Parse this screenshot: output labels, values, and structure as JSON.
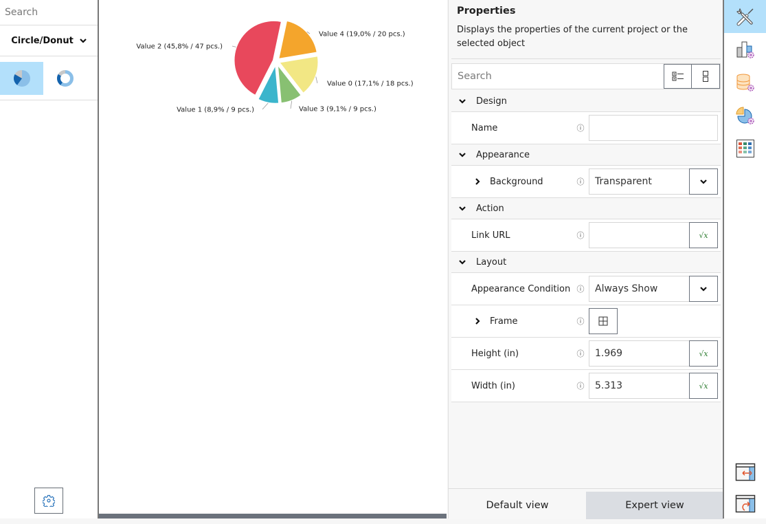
{
  "left_panel": {
    "search_placeholder": "Search",
    "chart_type": "Circle/Donut",
    "variants": [
      {
        "name": "pie",
        "selected": true
      },
      {
        "name": "donut",
        "selected": false
      }
    ],
    "settings_icon": "gear-icon"
  },
  "chart_data": {
    "type": "pie",
    "title": "",
    "series": [
      {
        "label": "Value 4 (19,0% / 20 pcs.)",
        "name": "Value 4",
        "percent": 19.0,
        "count": 20,
        "color": "#f4a52c"
      },
      {
        "label": "Value 0 (17,1% / 18 pcs.)",
        "name": "Value 0",
        "percent": 17.1,
        "count": 18,
        "color": "#f2e784"
      },
      {
        "label": "Value 3 (9,1% / 9 pcs.)",
        "name": "Value 3",
        "percent": 9.1,
        "count": 9,
        "color": "#88c072"
      },
      {
        "label": "Value 1 (8,9% / 9 pcs.)",
        "name": "Value 1",
        "percent": 8.9,
        "count": 9,
        "color": "#3bb5cc"
      },
      {
        "label": "Value 2 (45,8% / 47 pcs.)",
        "name": "Value 2",
        "percent": 45.8,
        "count": 47,
        "color": "#e8485c"
      }
    ],
    "legend": "none",
    "data_labels": "outside"
  },
  "properties": {
    "title": "Properties",
    "description": "Displays the properties of the current project or the selected object",
    "search_placeholder": "Search",
    "categories": {
      "design": "Design",
      "appearance": "Appearance",
      "action": "Action",
      "layout": "Layout"
    },
    "rows": {
      "name": {
        "label": "Name",
        "value": ""
      },
      "background": {
        "label": "Background",
        "value": "Transparent"
      },
      "link_url": {
        "label": "Link URL",
        "value": ""
      },
      "appearance_condition": {
        "label": "Appearance Condition",
        "value": "Always Show"
      },
      "frame": {
        "label": "Frame"
      },
      "height": {
        "label": "Height (in)",
        "value": "1.969"
      },
      "width": {
        "label": "Width (in)",
        "value": "5.313"
      }
    },
    "info_glyph": "ⓘ",
    "formula_glyph": "√x",
    "views": {
      "default": "Default view",
      "expert": "Expert view",
      "active": "expert"
    }
  },
  "toolbar": {
    "items": [
      "properties-tools",
      "chart-settings",
      "data-source-settings",
      "pie-settings",
      "table-grid"
    ],
    "bottom": [
      "swap-panel",
      "redo-panel"
    ]
  }
}
